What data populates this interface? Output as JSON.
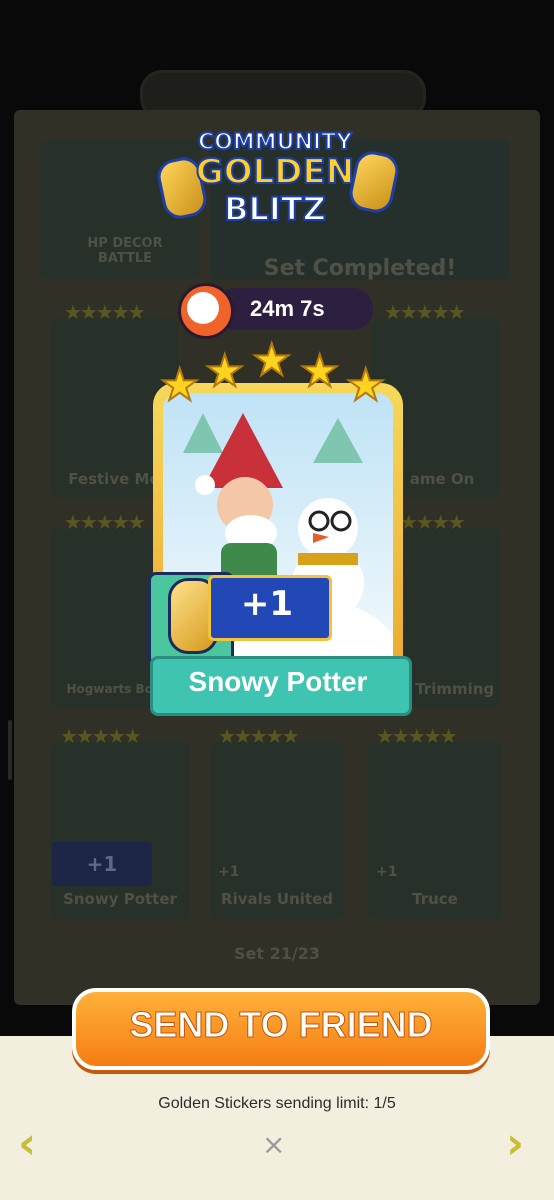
{
  "event": {
    "title_line1": "COMMUNITY",
    "title_line2": "GOLDEN",
    "title_line3": "BLITZ"
  },
  "timer": {
    "remaining": "24m 7s"
  },
  "album_background": {
    "header_partial": "HP DECOR BATTLE",
    "status": "Set Completed!",
    "set_progress": "Set 21/23",
    "cards": [
      {
        "label": "Festive Mo"
      },
      {
        "label": "ame On"
      },
      {
        "label": "Hogwarts Bou"
      },
      {
        "label": "e Trimming"
      },
      {
        "label": "Snowy Potter",
        "badge": "+1"
      },
      {
        "label": "Rivals United",
        "badge": "+1"
      },
      {
        "label": "Truce",
        "badge": "+1"
      }
    ]
  },
  "featured_card": {
    "name": "Snowy Potter",
    "stars": 5,
    "bonus": "+1"
  },
  "actions": {
    "send_label": "SEND TO FRIEND",
    "limit_text": "Golden Stickers sending limit: 1/5",
    "close_icon": "×",
    "prev_icon": "‹",
    "next_icon": "›"
  },
  "colors": {
    "send_button": "#f67d14",
    "banner": "#3ec4b0",
    "plus_box": "#2247b6",
    "timer_pill": "#2c1f3f"
  }
}
